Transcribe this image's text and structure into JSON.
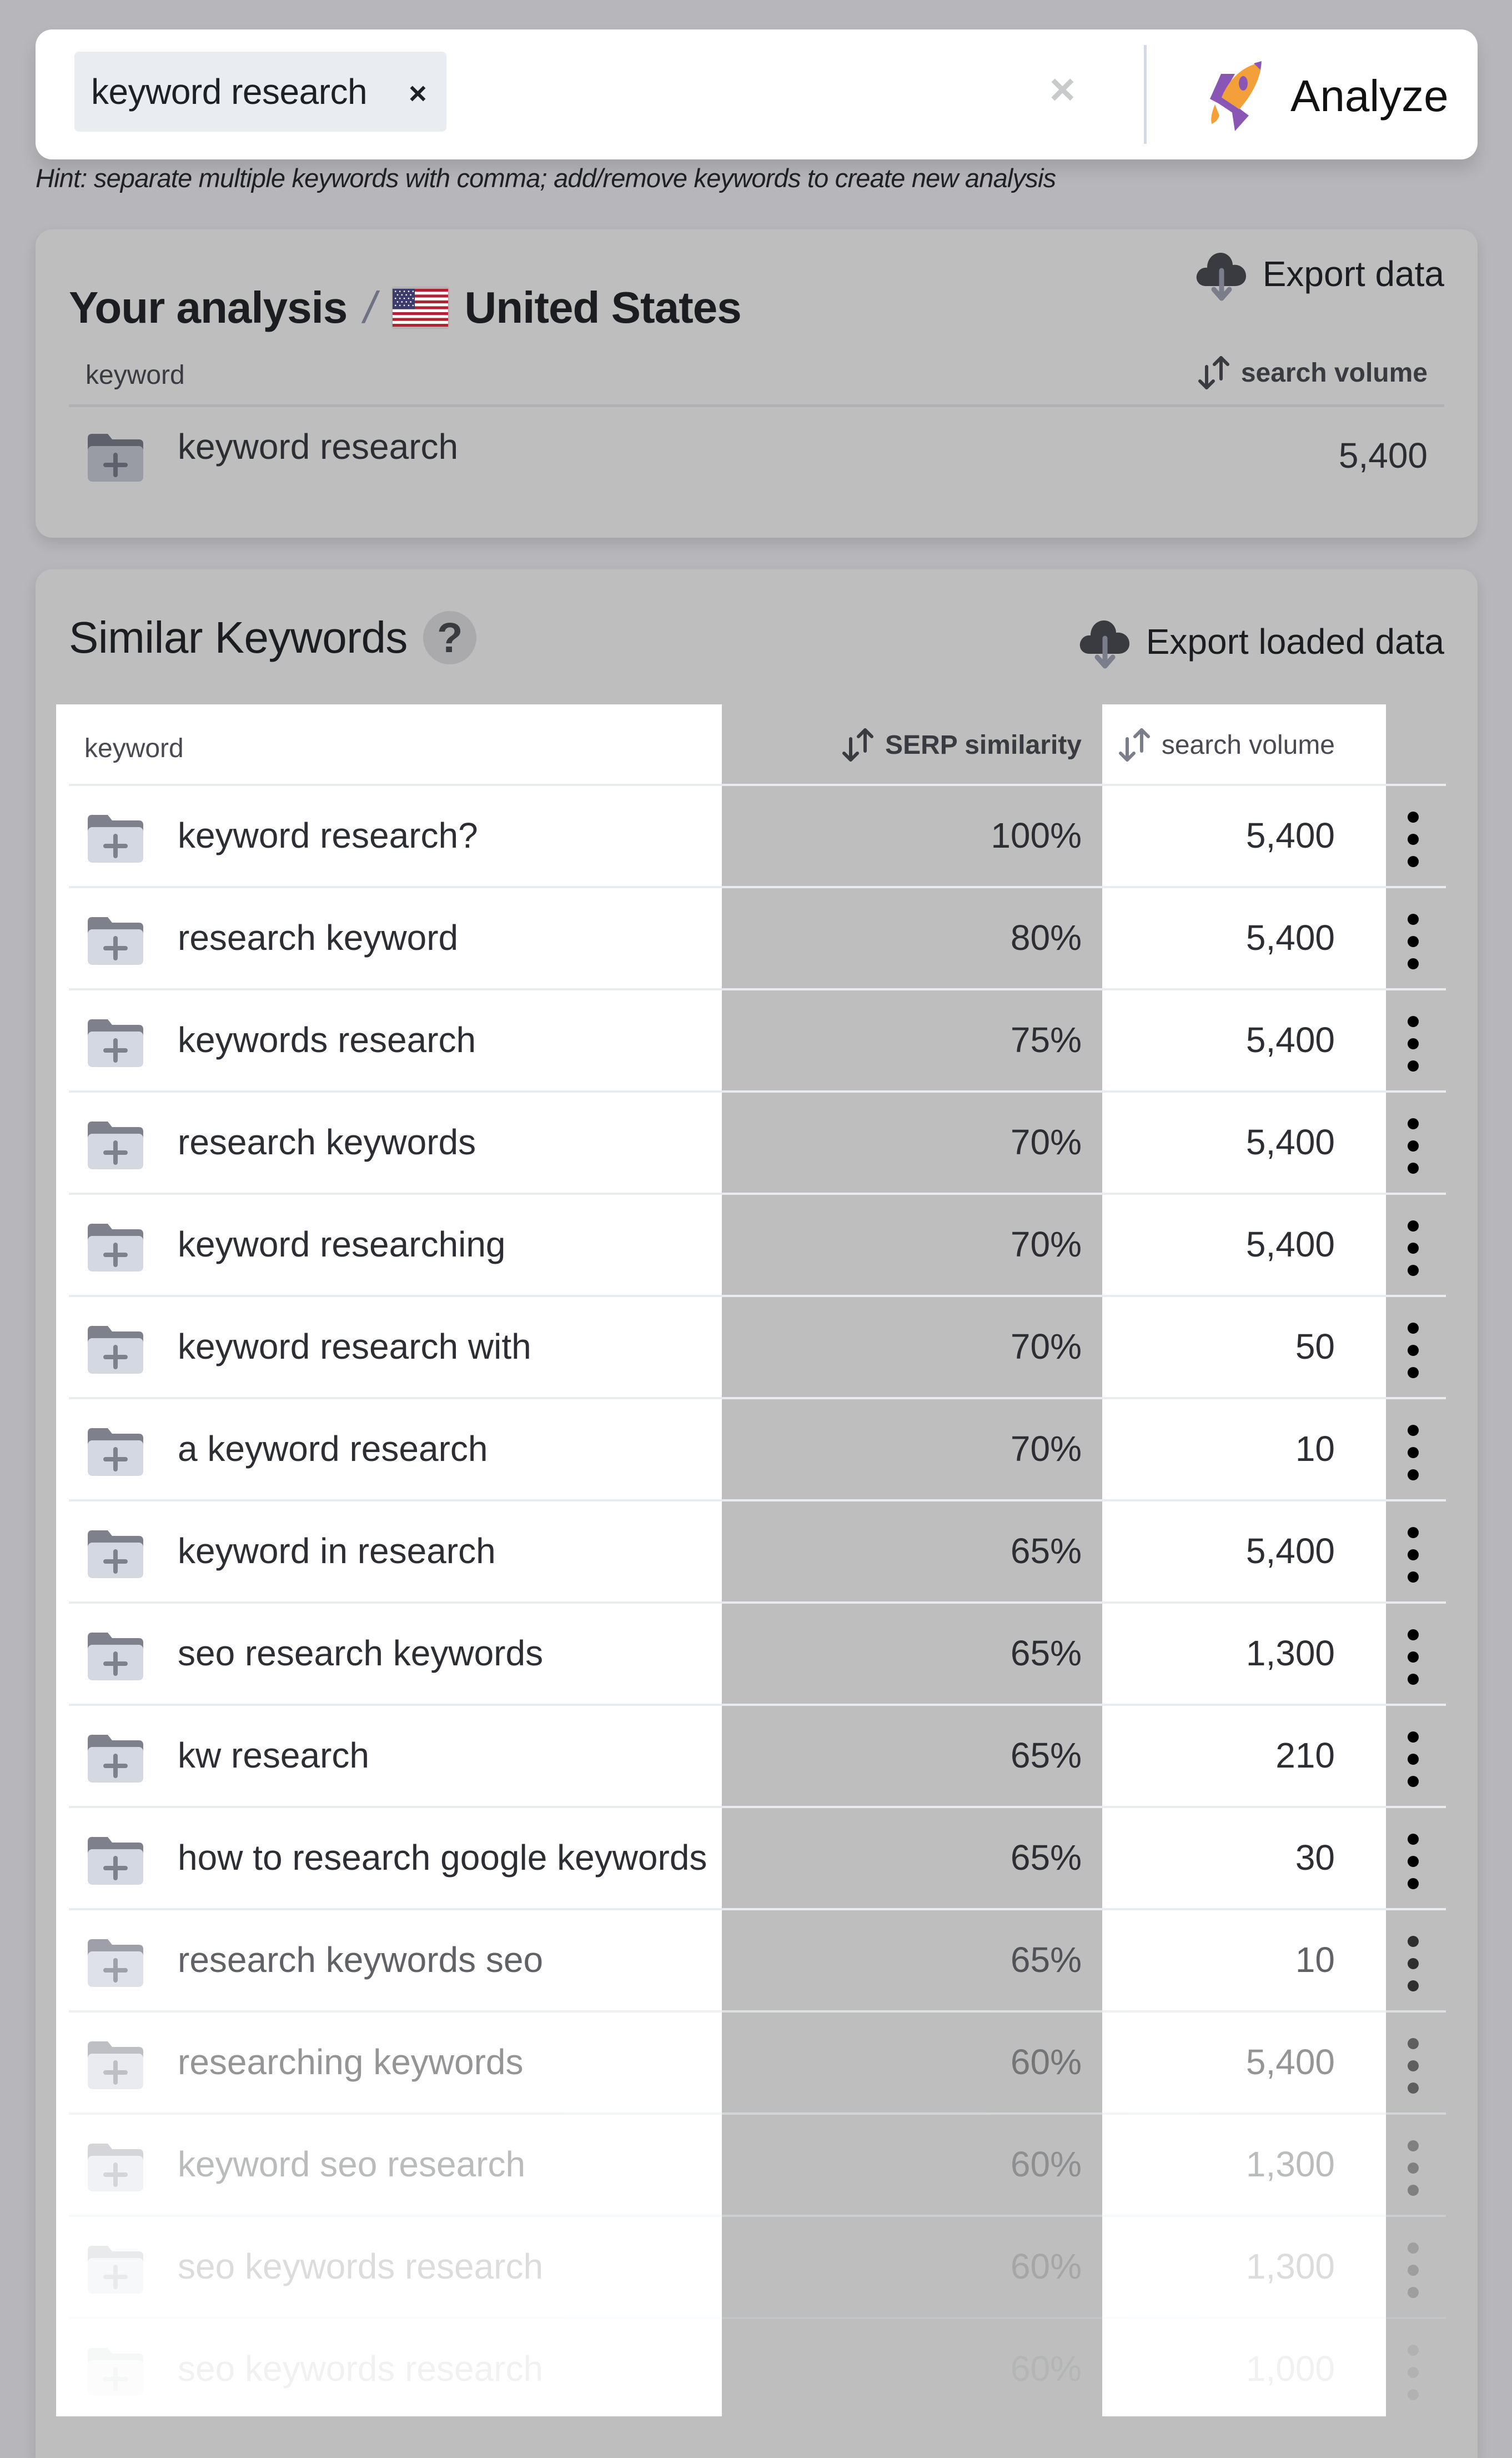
{
  "search": {
    "chips": [
      {
        "label": "keyword research",
        "remove_icon": "close-icon"
      }
    ],
    "clear_icon": "close-icon",
    "analyze_label": "Analyze",
    "analyze_icon": "rocket-icon",
    "hint": "Hint: separate multiple keywords with comma; add/remove keywords to create new analysis"
  },
  "analysis": {
    "title": "Your analysis",
    "separator": "/",
    "country": "United States",
    "country_flag": "us-flag-icon",
    "export_label": "Export data",
    "columns": {
      "keyword": "keyword",
      "search_volume": "search volume"
    },
    "rows": [
      {
        "keyword": "keyword research",
        "search_volume": "5,400"
      }
    ]
  },
  "similar": {
    "title": "Similar Keywords",
    "help_label": "?",
    "export_label": "Export loaded data",
    "columns": {
      "keyword": "keyword",
      "serp_similarity": "SERP similarity",
      "search_volume": "search volume"
    },
    "rows": [
      {
        "keyword": "keyword research?",
        "serp": "100%",
        "volume": "5,400"
      },
      {
        "keyword": "research keyword",
        "serp": "80%",
        "volume": "5,400"
      },
      {
        "keyword": "keywords research",
        "serp": "75%",
        "volume": "5,400"
      },
      {
        "keyword": "research keywords",
        "serp": "70%",
        "volume": "5,400"
      },
      {
        "keyword": "keyword researching",
        "serp": "70%",
        "volume": "5,400"
      },
      {
        "keyword": "keyword research with",
        "serp": "70%",
        "volume": "50"
      },
      {
        "keyword": "a keyword research",
        "serp": "70%",
        "volume": "10"
      },
      {
        "keyword": "keyword in research",
        "serp": "65%",
        "volume": "5,400"
      },
      {
        "keyword": "seo research keywords",
        "serp": "65%",
        "volume": "1,300"
      },
      {
        "keyword": "kw research",
        "serp": "65%",
        "volume": "210"
      },
      {
        "keyword": "how to research google keywords",
        "serp": "65%",
        "volume": "30"
      },
      {
        "keyword": "research keywords seo",
        "serp": "65%",
        "volume": "10"
      },
      {
        "keyword": "researching keywords",
        "serp": "60%",
        "volume": "5,400"
      },
      {
        "keyword": "keyword seo research",
        "serp": "60%",
        "volume": "1,300"
      },
      {
        "keyword": "seo keywords research",
        "serp": "60%",
        "volume": "1,300"
      },
      {
        "keyword": "seo keywords research",
        "serp": "60%",
        "volume": "1,000"
      }
    ]
  },
  "colors": {
    "overlay": "#b7b7bb",
    "rocket_orange": "#f4a03a",
    "rocket_purple": "#8a56b5",
    "folder_tab": "#7e808c",
    "folder_body": "#d4d8e2"
  }
}
